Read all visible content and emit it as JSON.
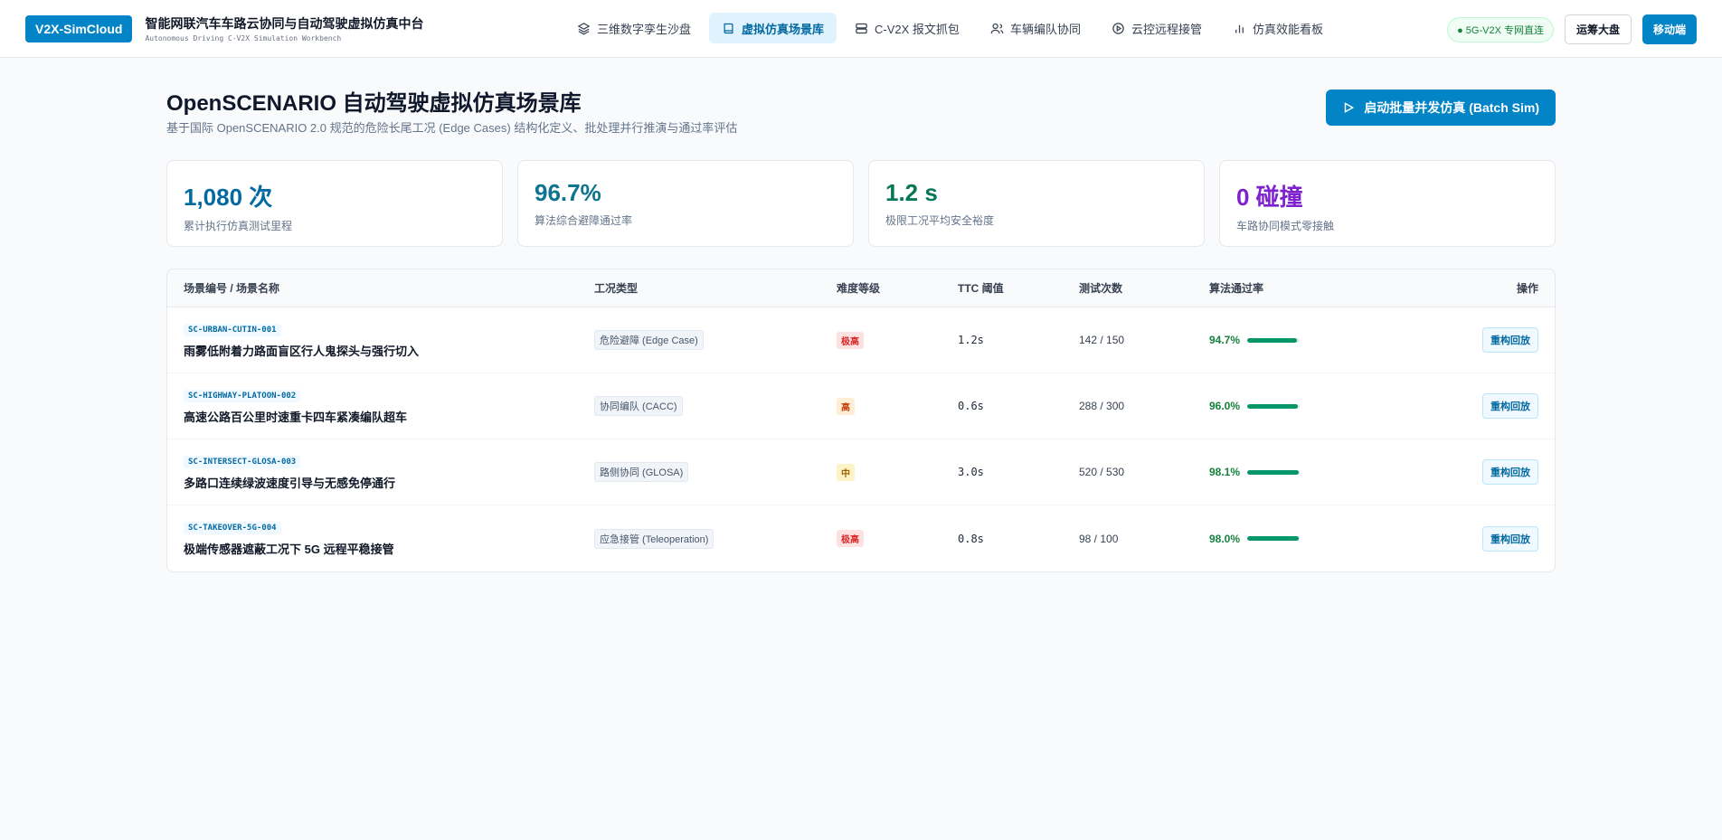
{
  "header": {
    "logo": "V2X-SimCloud",
    "title": "智能网联汽车车路云协同与自动驾驶虚拟仿真中台",
    "subtitle": "Autonomous Driving C-V2X Simulation Workbench",
    "nav": [
      {
        "label": "三维数字孪生沙盘",
        "icon": "layers-icon"
      },
      {
        "label": "虚拟仿真场景库",
        "icon": "book-icon",
        "active": true
      },
      {
        "label": "C-V2X 报文抓包",
        "icon": "server-icon"
      },
      {
        "label": "车辆编队协同",
        "icon": "users-icon"
      },
      {
        "label": "云控远程接管",
        "icon": "play-circle-icon"
      },
      {
        "label": "仿真效能看板",
        "icon": "bar-chart-icon"
      }
    ],
    "network_badge": "● 5G-V2X 专网直连",
    "ops_button": "运筹大盘",
    "mobile_button": "移动端"
  },
  "page": {
    "title": "OpenSCENARIO 自动驾驶虚拟仿真场景库",
    "description": "基于国际 OpenSCENARIO 2.0 规范的危险长尾工况 (Edge Cases) 结构化定义、批处理并行推演与通过率评估",
    "batch_button": "启动批量并发仿真 (Batch Sim)"
  },
  "stats": [
    {
      "value": "1,080 次",
      "label": "累计执行仿真测试里程",
      "color": "#0369a1"
    },
    {
      "value": "96.7%",
      "label": "算法综合避障通过率",
      "color": "#0e7490"
    },
    {
      "value": "1.2 s",
      "label": "极限工况平均安全裕度",
      "color": "#047857"
    },
    {
      "value": "0 碰撞",
      "label": "车路协同模式零接触",
      "color": "#7e22ce"
    }
  ],
  "table": {
    "headers": [
      "场景编号 / 场景名称",
      "工况类型",
      "难度等级",
      "TTC 阈值",
      "测试次数",
      "算法通过率",
      "操作"
    ],
    "rows": [
      {
        "code": "SC-URBAN-CUTIN-001",
        "name": "雨雾低附着力路面盲区行人鬼探头与强行切入",
        "type": "危险避障 (Edge Case)",
        "difficulty": "极高",
        "diff_color": "#dc2626",
        "diff_bg": "#fee2e2",
        "ttc": "1.2s",
        "runs": "142 / 150",
        "pass_rate": "94.7%",
        "pass_value": 94.7,
        "action": "重构回放"
      },
      {
        "code": "SC-HIGHWAY-PLATOON-002",
        "name": "高速公路百公里时速重卡四车紧凑编队超车",
        "type": "协同编队 (CACC)",
        "difficulty": "高",
        "diff_color": "#c2410c",
        "diff_bg": "#ffedd5",
        "ttc": "0.6s",
        "runs": "288 / 300",
        "pass_rate": "96.0%",
        "pass_value": 96.0,
        "action": "重构回放"
      },
      {
        "code": "SC-INTERSECT-GLOSA-003",
        "name": "多路口连续绿波速度引导与无感免停通行",
        "type": "路侧协同 (GLOSA)",
        "difficulty": "中",
        "diff_color": "#a16207",
        "diff_bg": "#fef3c7",
        "ttc": "3.0s",
        "runs": "520 / 530",
        "pass_rate": "98.1%",
        "pass_value": 98.1,
        "action": "重构回放"
      },
      {
        "code": "SC-TAKEOVER-5G-004",
        "name": "极端传感器遮蔽工况下 5G 远程平稳接管",
        "type": "应急接管 (Teleoperation)",
        "difficulty": "极高",
        "diff_color": "#dc2626",
        "diff_bg": "#fee2e2",
        "ttc": "0.8s",
        "runs": "98 / 100",
        "pass_rate": "98.0%",
        "pass_value": 98.0,
        "action": "重构回放"
      }
    ]
  }
}
